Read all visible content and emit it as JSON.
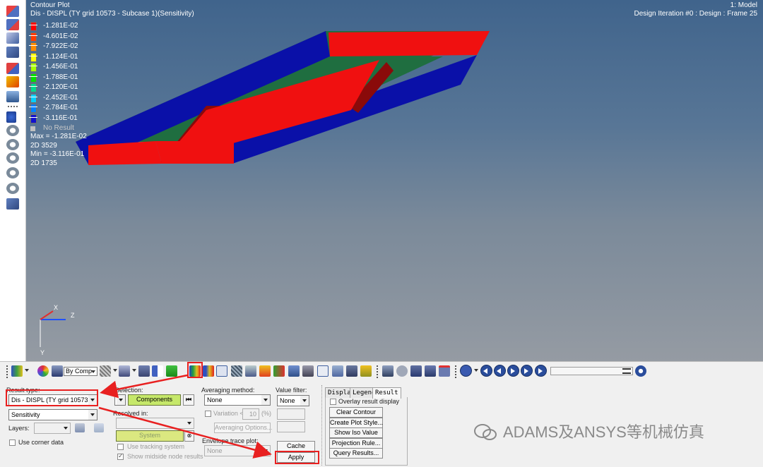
{
  "viewport": {
    "plot_title": "Contour Plot",
    "plot_subtitle": "Dis - DISPL (TY grid 10573 - Subcase 1)(Sensitivity)",
    "model_label": "1: Model",
    "iteration_label": "Design Iteration #0 : Design : Frame 25",
    "axis_x": "X",
    "axis_y": "Y",
    "axis_z": "Z",
    "stats": {
      "max": "Max = -1.281E-02",
      "max_id": "2D 3529",
      "min": "Min = -3.116E-01",
      "min_id": "2D 1735"
    }
  },
  "legend": {
    "entries": [
      {
        "label": "-1.281E-02",
        "color": "#ff0000"
      },
      {
        "label": "-4.601E-02",
        "color": "#ff3a00"
      },
      {
        "label": "-7.922E-02",
        "color": "#ff8c00"
      },
      {
        "label": "-1.124E-01",
        "color": "#ffff00"
      },
      {
        "label": "-1.456E-01",
        "color": "#a8ff00"
      },
      {
        "label": "-1.788E-01",
        "color": "#00e000"
      },
      {
        "label": "-2.120E-01",
        "color": "#00d890"
      },
      {
        "label": "-2.452E-01",
        "color": "#00d0ff"
      },
      {
        "label": "-2.784E-01",
        "color": "#0080ff"
      },
      {
        "label": "-3.116E-01",
        "color": "#1010d0"
      }
    ],
    "no_result_label": "No Result",
    "no_result_color": "#c0c0c0"
  },
  "toolbar": {
    "by_comp_label": "By Comp"
  },
  "panel": {
    "result_type_label": "Result type:",
    "result_type_value": "Dis - DISPL (TY grid 10573 - Su",
    "sensitivity_value": "Sensitivity",
    "layers_label": "Layers:",
    "use_corner_data_label": "Use corner data",
    "selection_label": "Selection:",
    "components_label": "Components",
    "resolved_in_label": "Resolved in:",
    "system_label": "System",
    "use_tracking_label": "Use tracking system",
    "show_midside_label": "Show midside node results",
    "averaging_label": "Averaging method:",
    "averaging_value": "None",
    "variation_label": "Variation <",
    "variation_value": "10",
    "variation_unit": "(%)",
    "averaging_options_label": "Averaging Options...",
    "envelope_label": "Envelope trace plot:",
    "envelope_value": "None",
    "value_filter_label": "Value filter:",
    "value_filter_value": "None",
    "cache_label": "Cache",
    "apply_label": "Apply"
  },
  "tabs": {
    "display": "Display",
    "legend": "Legend",
    "result": "Result"
  },
  "result_tab": {
    "overlay_label": "Overlay result display",
    "clear_contour": "Clear Contour",
    "create_plot_style": "Create Plot Style...",
    "show_iso_value": "Show Iso Value",
    "projection_rule": "Projection Rule...",
    "query_results": "Query Results..."
  },
  "watermark": {
    "text": "ADAMS及ANSYS等机械仿真"
  }
}
